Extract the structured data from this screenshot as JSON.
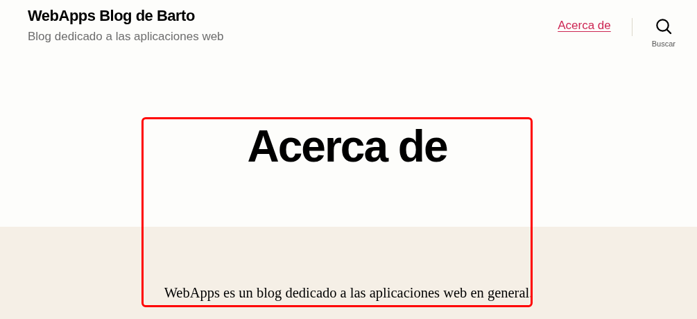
{
  "site": {
    "title": "WebApps Blog de Barto",
    "tagline": "Blog dedicado a las aplicaciones web"
  },
  "nav": {
    "link": "Acerca de",
    "search_label": "Buscar"
  },
  "page": {
    "title": "Acerca de",
    "paragraph": "WebApps es un blog dedicado a las aplicaciones web en general."
  },
  "highlight": true
}
